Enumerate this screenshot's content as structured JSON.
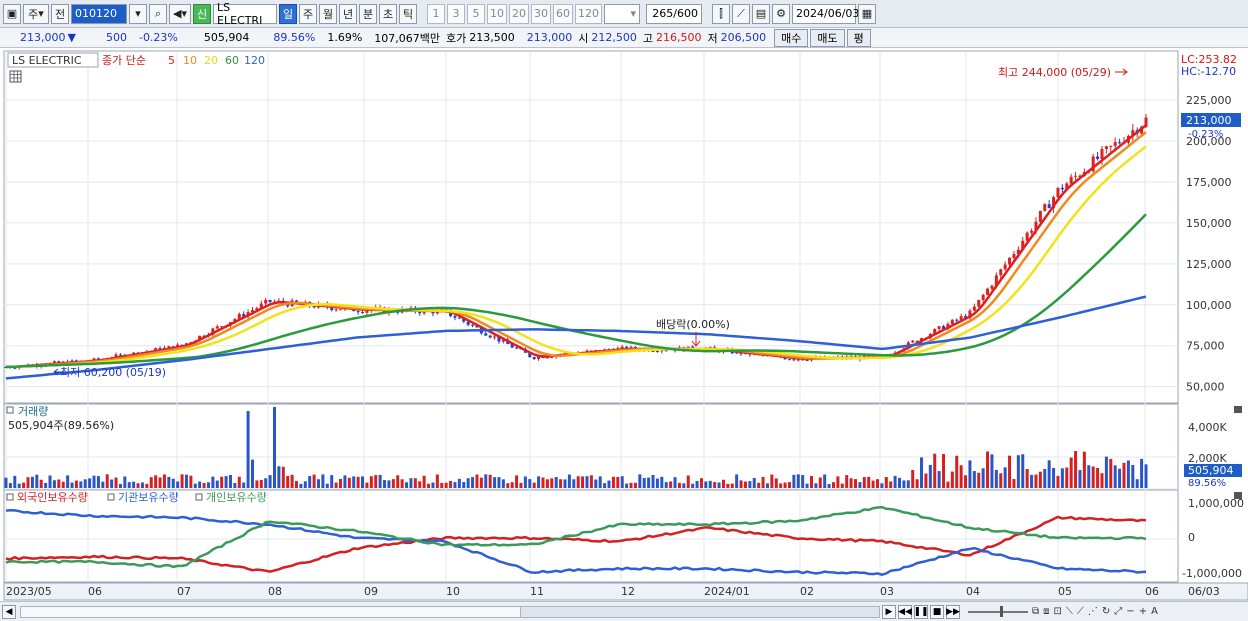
{
  "toolbar": {
    "period_label": "주",
    "prev_label": "전",
    "code": "010120",
    "new_badge": "신",
    "stock_name": "LS ELECTRI",
    "periods": [
      "일",
      "주",
      "월",
      "년",
      "분",
      "초",
      "틱"
    ],
    "active_period": "일",
    "intervals": [
      "1",
      "3",
      "5",
      "10",
      "20",
      "30",
      "60",
      "120"
    ],
    "count": "265",
    "count_max": "/600",
    "date": "2024/06/03"
  },
  "quote": {
    "price": "213,000",
    "change": "500",
    "change_pct": "-0.23%",
    "volume": "505,904",
    "volume_pct": "89.56%",
    "turnover_pct": "1.69%",
    "amount": "107,067백만",
    "ask_label": "호가",
    "ask1": "213,500",
    "ask2": "213,000",
    "open_label": "시",
    "open": "212,500",
    "high_label": "고",
    "high": "216,500",
    "low_label": "저",
    "low": "206,500",
    "buy_label": "매수",
    "sell_label": "매도",
    "eval_label": "평"
  },
  "price_panel": {
    "legend_name": "LS ELECTRIC",
    "legend_ma_label": "종가 단순",
    "ma_periods": [
      "5",
      "10",
      "20",
      "60",
      "120"
    ],
    "ma_colors": [
      "#e01e1e",
      "#f08a1c",
      "#f2e21a",
      "#2a9a3c",
      "#2f5fd6"
    ],
    "lc_label": "LC:253.82",
    "hc_label": "HC:-12.70",
    "high_annotation": "최고 244,000 (05/29)",
    "low_annotation": "최저 60,200 (05/19)",
    "dividend_annotation": "배당락(0.00%)",
    "last_price_tag": "213,000",
    "last_change_tag": "-0.23%",
    "y_ticks": [
      "225,000",
      "200,000",
      "175,000",
      "150,000",
      "125,000",
      "100,000",
      "75,000",
      "50,000"
    ]
  },
  "volume_panel": {
    "title": "거래량",
    "subtitle": "505,904주(89.56%)",
    "y_ticks": [
      "4,000K",
      "2,000K"
    ],
    "last_tag": "505,904",
    "last_pct": "89.56%"
  },
  "holdings_panel": {
    "legend": [
      "외국인보유수량",
      "기관보유수량",
      "개인보유수량"
    ],
    "colors": [
      "#d42020",
      "#2f5fd6",
      "#3a9a5a"
    ],
    "y_ticks": [
      "1,000,000",
      "0",
      "-1,000,000"
    ]
  },
  "x_axis": [
    "2023/05",
    "06",
    "07",
    "08",
    "09",
    "10",
    "11",
    "12",
    "2024/01",
    "02",
    "03",
    "04",
    "05",
    "06",
    "06/03"
  ],
  "chart_data": {
    "type": "line",
    "x": [
      "2023/05",
      "2023/06",
      "2023/07",
      "2023/08",
      "2023/09",
      "2023/10",
      "2023/11",
      "2023/12",
      "2024/01",
      "2024/02",
      "2024/03",
      "2024/04",
      "2024/05",
      "2024/06/03"
    ],
    "series": [
      {
        "name": "LS ELECTRIC",
        "values": [
          62000,
          66000,
          75000,
          102000,
          97000,
          96000,
          68000,
          73000,
          73000,
          67000,
          68000,
          95000,
          170000,
          213000
        ]
      },
      {
        "name": "120",
        "values": [
          55000,
          60000,
          66000,
          73000,
          80000,
          84000,
          85000,
          84000,
          82000,
          78000,
          73000,
          80000,
          92000,
          105000
        ]
      },
      {
        "name": "외국인보유수량",
        "values": [
          -600000,
          -550000,
          -600000,
          -1000000,
          -300000,
          0,
          0,
          -100000,
          300000,
          0,
          -100000,
          -500000,
          600000,
          500000
        ]
      },
      {
        "name": "기관보유수량",
        "values": [
          800000,
          650000,
          600000,
          400000,
          0,
          -100000,
          -1000000,
          -900000,
          -900000,
          -1000000,
          -1050000,
          -300000,
          -900000,
          -1000000
        ]
      },
      {
        "name": "개인보유수량",
        "values": [
          -700000,
          -700000,
          -850000,
          500000,
          200000,
          -200000,
          -200000,
          400000,
          400000,
          500000,
          900000,
          300000,
          0,
          0
        ]
      }
    ],
    "ylim": [
      40000,
      255000
    ],
    "grid": true
  }
}
